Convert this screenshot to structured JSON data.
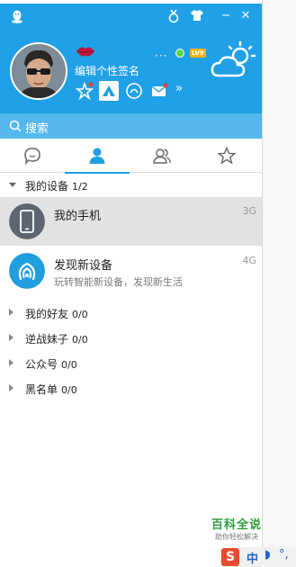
{
  "header": {
    "signature": "编辑个性签名",
    "status_dots": "···",
    "level": "LV9",
    "more": "»"
  },
  "window_controls": {
    "medal_icon": "medal-icon",
    "skin_icon": "tshirt-icon",
    "minimize": "−",
    "close": "✕"
  },
  "search": {
    "placeholder": "搜索"
  },
  "tabs": [
    {
      "id": "messages",
      "icon": "chat-bubble-icon"
    },
    {
      "id": "contacts",
      "icon": "person-icon",
      "active": true
    },
    {
      "id": "groups",
      "icon": "group-icon"
    },
    {
      "id": "favorites",
      "icon": "star-outline-icon"
    }
  ],
  "groups": {
    "devices": {
      "name": "我的设备",
      "count": "1/2"
    },
    "friends": {
      "name": "我的好友",
      "count": "0/0"
    },
    "nizhan": {
      "name": "逆战妹子",
      "count": "0/0"
    },
    "official": {
      "name": "公众号",
      "count": "0/0"
    },
    "blacklist": {
      "name": "黑名单",
      "count": "0/0"
    }
  },
  "devices": [
    {
      "name": "我的手机",
      "network": "3G",
      "subtitle": ""
    },
    {
      "name": "发现新设备",
      "network": "4G",
      "subtitle": "玩转智能新设备，发现新生活"
    }
  ],
  "watermark": {
    "title": "百科全说",
    "subtitle": "助你轻松解决"
  },
  "tray": {
    "ime": "中",
    "moon": "◗",
    "dot": "°,"
  },
  "colors": {
    "header_bg": "#20a0e6",
    "search_bg": "#54b8ec",
    "accent": "#1f9ee0",
    "selected_row": "#e2e2e2"
  }
}
